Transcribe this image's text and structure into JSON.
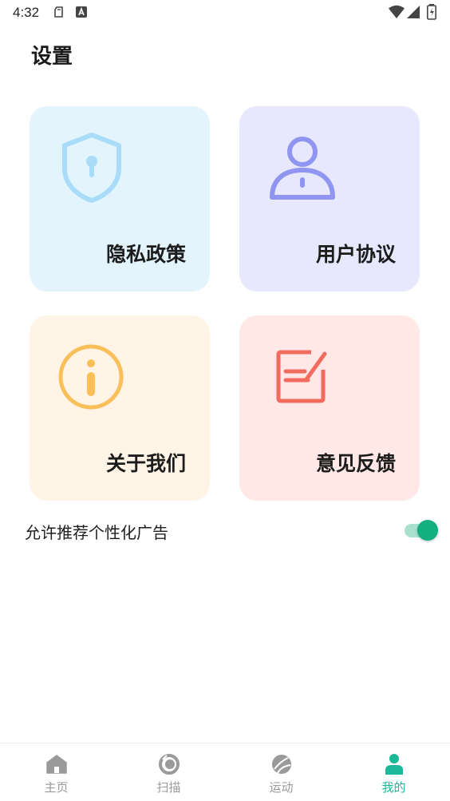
{
  "status_bar": {
    "time": "4:32",
    "icons": [
      "sd-card-icon",
      "a-badge-icon",
      "wifi-icon",
      "signal-icon",
      "battery-icon"
    ]
  },
  "page": {
    "title": "设置"
  },
  "cards": [
    {
      "label": "隐私政策",
      "icon": "shield-icon",
      "bg": "#e3f4fd",
      "icon_color": "#a8dcf8"
    },
    {
      "label": "用户协议",
      "icon": "user-icon",
      "bg": "#e7e8fd",
      "icon_color": "#8f95f0"
    },
    {
      "label": "关于我们",
      "icon": "info-icon",
      "bg": "#fff4e6",
      "icon_color": "#fbbf5a"
    },
    {
      "label": "意见反馈",
      "icon": "edit-icon",
      "bg": "#ffe8e6",
      "icon_color": "#f26b5f"
    }
  ],
  "settings": {
    "personalized_ads": {
      "label": "允许推荐个性化广告",
      "enabled": true,
      "accent": "#12b07e"
    }
  },
  "bottom_nav": {
    "items": [
      {
        "label": "主页",
        "icon": "home-icon",
        "active": false
      },
      {
        "label": "扫描",
        "icon": "scan-icon",
        "active": false
      },
      {
        "label": "运动",
        "icon": "sport-ball-icon",
        "active": false
      },
      {
        "label": "我的",
        "icon": "profile-icon",
        "active": true
      }
    ],
    "active_color": "#1cb89a",
    "inactive_color": "#9a9a9a"
  }
}
